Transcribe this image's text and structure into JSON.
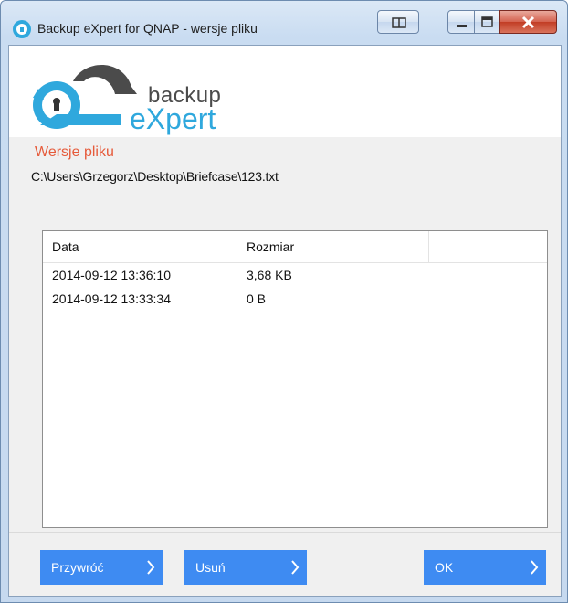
{
  "window": {
    "title": "Backup eXpert for QNAP - wersje pliku"
  },
  "logo": {
    "line1": "backup",
    "line2": "eXpert"
  },
  "section": {
    "title": "Wersje pliku",
    "file_path": "C:\\Users\\Grzegorz\\Desktop\\Briefcase\\123.txt"
  },
  "table": {
    "columns": [
      "Data",
      "Rozmiar",
      ""
    ],
    "rows": [
      {
        "date": "2014-09-12 13:36:10",
        "size": "3,68 KB"
      },
      {
        "date": "2014-09-12 13:33:34",
        "size": "0 B"
      }
    ]
  },
  "buttons": {
    "restore": "Przywróć",
    "delete": "Usuń",
    "ok": "OK"
  },
  "colors": {
    "accent": "#3e8bf2",
    "section_title": "#e65a3a",
    "logo_blue": "#2fa8dd"
  }
}
